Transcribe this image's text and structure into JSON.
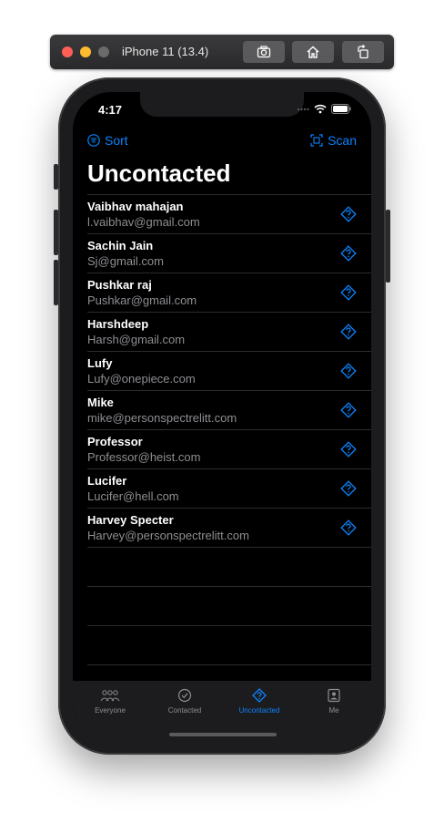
{
  "simulator": {
    "title": "iPhone 11 (13.4)"
  },
  "status_bar": {
    "time": "4:17"
  },
  "nav": {
    "sort_label": "Sort",
    "scan_label": "Scan"
  },
  "page": {
    "title": "Uncontacted"
  },
  "contacts": [
    {
      "name": "Vaibhav mahajan",
      "email": "l.vaibhav@gmail.com"
    },
    {
      "name": "Sachin Jain",
      "email": "Sj@gmail.com"
    },
    {
      "name": "Pushkar raj",
      "email": "Pushkar@gmail.com"
    },
    {
      "name": "Harshdeep",
      "email": "Harsh@gmail.com"
    },
    {
      "name": "Lufy",
      "email": "Lufy@onepiece.com"
    },
    {
      "name": "Mike",
      "email": "mike@personspectrelitt.com"
    },
    {
      "name": "Professor",
      "email": "Professor@heist.com"
    },
    {
      "name": "Lucifer",
      "email": "Lucifer@hell.com"
    },
    {
      "name": "Harvey Specter",
      "email": "Harvey@personspectrelitt.com"
    }
  ],
  "tabs": [
    {
      "label": "Everyone",
      "icon": "people-icon",
      "active": false
    },
    {
      "label": "Contacted",
      "icon": "checkmark-circle-icon",
      "active": false
    },
    {
      "label": "Uncontacted",
      "icon": "question-diamond-icon",
      "active": true
    },
    {
      "label": "Me",
      "icon": "person-square-icon",
      "active": false
    }
  ],
  "colors": {
    "accent": "#0a84ff",
    "background": "#000000",
    "secondary_text": "#8e8e93"
  }
}
